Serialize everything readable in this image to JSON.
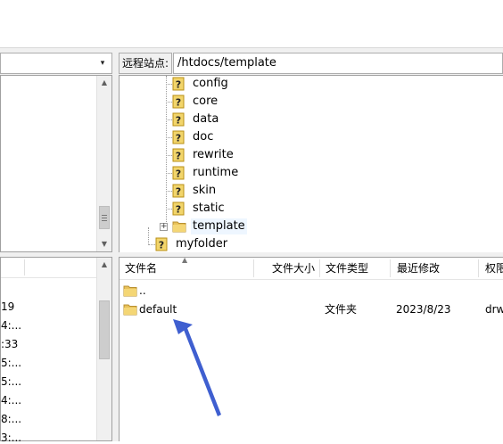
{
  "remote": {
    "label": "远程站点:",
    "path": "/htdocs/template"
  },
  "left_dropdown": "▾",
  "left_list_values": [
    "19",
    "4:...",
    ":33",
    "5:...",
    "5:...",
    "4:...",
    "8:...",
    "3:..."
  ],
  "remote_tree": [
    {
      "label": "config",
      "type": "unknown"
    },
    {
      "label": "core",
      "type": "unknown"
    },
    {
      "label": "data",
      "type": "unknown"
    },
    {
      "label": "doc",
      "type": "unknown"
    },
    {
      "label": "rewrite",
      "type": "unknown"
    },
    {
      "label": "runtime",
      "type": "unknown"
    },
    {
      "label": "skin",
      "type": "unknown"
    },
    {
      "label": "static",
      "type": "unknown"
    },
    {
      "label": "template",
      "type": "folder",
      "expandable": true,
      "selected": true
    },
    {
      "label": "myfolder",
      "type": "unknown"
    }
  ],
  "file_list": {
    "columns": [
      "文件名",
      "文件大小",
      "文件类型",
      "最近修改",
      "权限"
    ],
    "rows": [
      {
        "name": "..",
        "size": "",
        "type": "",
        "modified": "",
        "perms": ""
      },
      {
        "name": "default",
        "size": "",
        "type": "文件夹",
        "modified": "2023/8/23",
        "perms": "drw"
      }
    ]
  },
  "colors": {
    "folder": "#e8c15a",
    "unknown_icon": "#f2d56b",
    "selection": "#eef6ff",
    "annotation_arrow": "#3f5fd0"
  }
}
